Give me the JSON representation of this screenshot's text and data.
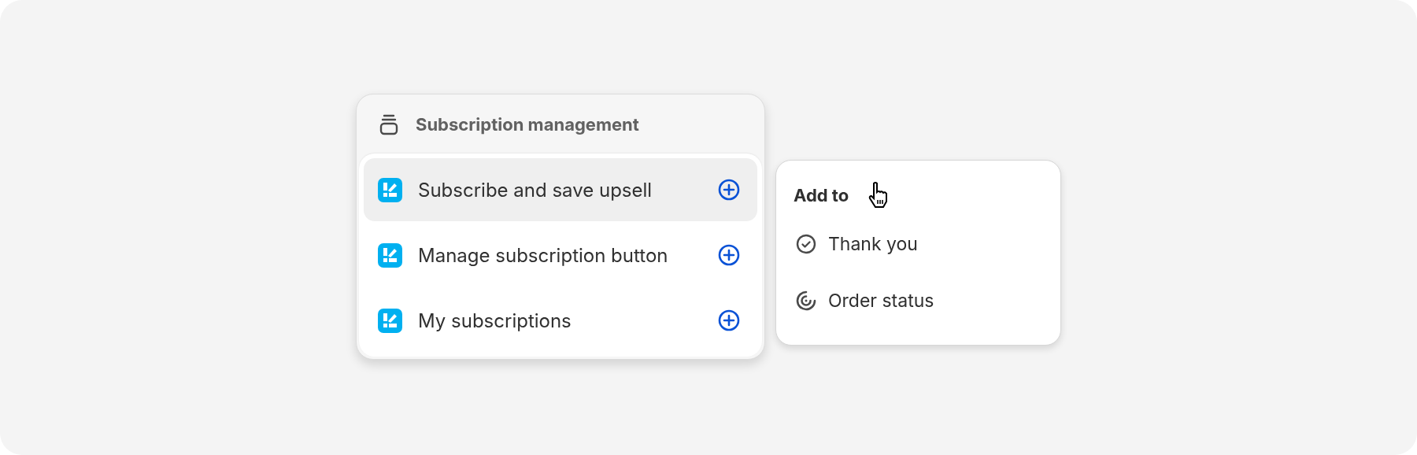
{
  "menu": {
    "title": "Subscription management",
    "items": [
      {
        "label": "Subscribe and save upsell",
        "selected": true
      },
      {
        "label": "Manage subscription button",
        "selected": false
      },
      {
        "label": "My subscriptions",
        "selected": false
      }
    ]
  },
  "popup": {
    "title": "Add to",
    "items": [
      {
        "label": "Thank you",
        "kind": "check"
      },
      {
        "label": "Order status",
        "kind": "status"
      }
    ]
  }
}
